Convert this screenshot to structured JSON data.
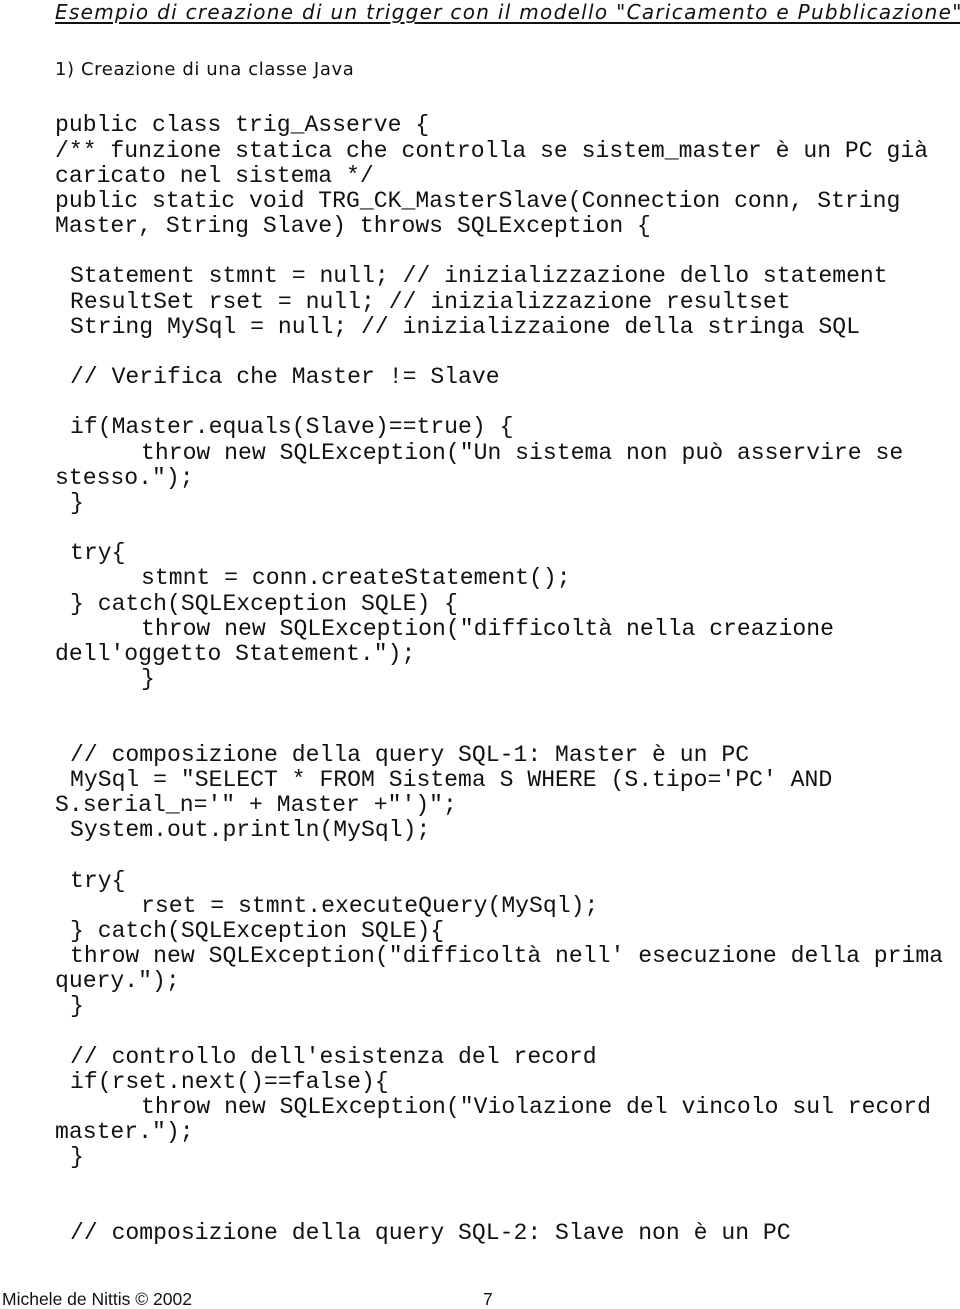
{
  "document": {
    "title": "Esempio di creazione di un trigger con il modello \"Caricamento e Pubblicazione\"",
    "section_heading": "1) Creazione di una classe Java",
    "code": {
      "lines": [
        {
          "text": "public class trig_Asserve {",
          "indent": 0
        },
        {
          "text": "/** funzione statica che controlla se sistem_master è un PC già",
          "indent": 0
        },
        {
          "text": "caricato nel sistema */",
          "indent": 0
        },
        {
          "text": "public static void TRG_CK_MasterSlave(Connection conn, String",
          "indent": 0
        },
        {
          "text": "Master, String Slave) throws SQLException {",
          "indent": 0
        },
        {
          "text": "",
          "indent": 0
        },
        {
          "text": "Statement stmnt = null; // inizializzazione dello statement",
          "indent": 1
        },
        {
          "text": "ResultSet rset = null; // inizializzazione resultset",
          "indent": 1
        },
        {
          "text": "String MySql = null; // inizializzaione della stringa SQL",
          "indent": 1
        },
        {
          "text": "",
          "indent": 0
        },
        {
          "text": "// Verifica che Master != Slave",
          "indent": 1
        },
        {
          "text": "",
          "indent": 0
        },
        {
          "text": "if(Master.equals(Slave)==true) {",
          "indent": 1
        },
        {
          "text": "throw new SQLException(\"Un sistema non può asservire se",
          "indent": 2
        },
        {
          "text": "stesso.\");",
          "indent": 0
        },
        {
          "text": "}",
          "indent": 1
        },
        {
          "text": "",
          "indent": 0
        },
        {
          "text": "try{",
          "indent": 1
        },
        {
          "text": "stmnt = conn.createStatement();",
          "indent": 2
        },
        {
          "text": "} catch(SQLException SQLE) {",
          "indent": 1
        },
        {
          "text": "throw new SQLException(\"difficoltà nella creazione",
          "indent": 2
        },
        {
          "text": "dell'oggetto Statement.\");",
          "indent": 0
        },
        {
          "text": "}",
          "indent": 2
        },
        {
          "text": "",
          "indent": 0
        },
        {
          "text": "",
          "indent": 0
        },
        {
          "text": "// composizione della query SQL-1: Master è un PC",
          "indent": 1
        },
        {
          "text": "MySql = \"SELECT * FROM Sistema S WHERE (S.tipo='PC' AND",
          "indent": 1
        },
        {
          "text": "S.serial_n='\" + Master +\"')\";",
          "indent": 0
        },
        {
          "text": "System.out.println(MySql);",
          "indent": 1
        },
        {
          "text": "",
          "indent": 0
        },
        {
          "text": "try{",
          "indent": 1
        },
        {
          "text": "rset = stmnt.executeQuery(MySql);",
          "indent": 2
        },
        {
          "text": "} catch(SQLException SQLE){",
          "indent": 1
        },
        {
          "text": "throw new SQLException(\"difficoltà nell' esecuzione della prima",
          "indent": 1
        },
        {
          "text": "query.\");",
          "indent": 0
        },
        {
          "text": "}",
          "indent": 1
        },
        {
          "text": "",
          "indent": 0
        },
        {
          "text": "// controllo dell'esistenza del record",
          "indent": 1
        },
        {
          "text": "if(rset.next()==false){",
          "indent": 1
        },
        {
          "text": "throw new SQLException(\"Violazione del vincolo sul record",
          "indent": 2
        },
        {
          "text": "master.\");",
          "indent": 0
        },
        {
          "text": "}",
          "indent": 1
        },
        {
          "text": "",
          "indent": 0
        },
        {
          "text": "",
          "indent": 0
        },
        {
          "text": "// composizione della query SQL-2: Slave non è un PC",
          "indent": 1
        }
      ]
    },
    "footer": {
      "author": "Michele de Nittis © 2002",
      "page_number": "7"
    }
  }
}
